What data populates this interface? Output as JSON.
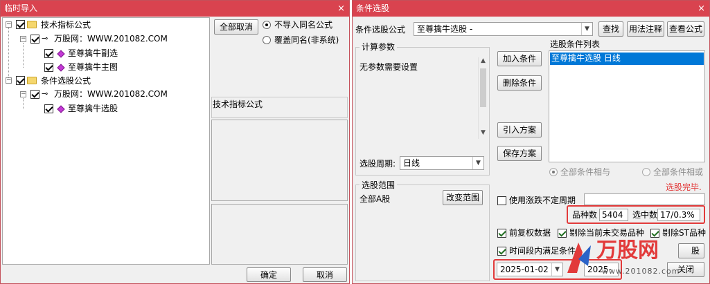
{
  "left_window": {
    "title": "临时导入",
    "close_glyph": "×",
    "tree": {
      "root1": "技术指标公式",
      "child1": "万股网：WWW.201082.COM",
      "leaf1": "至尊擒牛副选",
      "leaf2": "至尊擒牛主图",
      "root2": "条件选股公式",
      "child2": "万股网：WWW.201082.COM",
      "leaf3": "至尊擒牛选股"
    },
    "deselect_all": "全部取消",
    "radio_skip": "不导入同名公式",
    "radio_overwrite": "覆盖同名(非系统)",
    "info_header": "技术指标公式",
    "ok": "确定",
    "cancel": "取消"
  },
  "right_window": {
    "title": "条件选股",
    "close_glyph": "×",
    "formula_label": "条件选股公式",
    "formula_value": "至尊擒牛选股  -",
    "btn_find": "查找",
    "btn_usage": "用法注释",
    "btn_view": "查看公式",
    "calc_group": "计算参数",
    "no_params": "无参数需要设置",
    "period_label": "选股周期:",
    "period_value": "日线",
    "btn_add": "加入条件",
    "btn_delete": "删除条件",
    "btn_import": "引入方案",
    "btn_save": "保存方案",
    "cond_list_label": "选股条件列表",
    "cond_item": "至尊擒牛选股  日线",
    "radio_and": "全部条件相与",
    "radio_or": "全部条件相或",
    "status": "选股完毕.",
    "range_group": "选股范围",
    "range_value": "全部A股",
    "btn_change_range": "改变范围",
    "use_period": "使用涨跌不定周期",
    "count_label": "品种数",
    "count_value": "5404",
    "selected_label": "选中数",
    "selected_value": "17/0.3%",
    "chk_pre_adjust": "前复权数据",
    "chk_remove_notrade": "剔除当前未交易品种",
    "chk_remove_st": "剔除ST品种",
    "chk_time_range": "时间段内满足条件",
    "btn_right_partial": "股",
    "date_from": "2025-01-02",
    "date_to": "2025-03-10",
    "btn_close_partial": "关闭"
  },
  "watermark": {
    "logo_text": "万股网",
    "url": "www.201082.com"
  },
  "colors": {
    "title_bar": "#d9434f",
    "highlight_box": "#e23a3a",
    "selection": "#0078d7"
  }
}
